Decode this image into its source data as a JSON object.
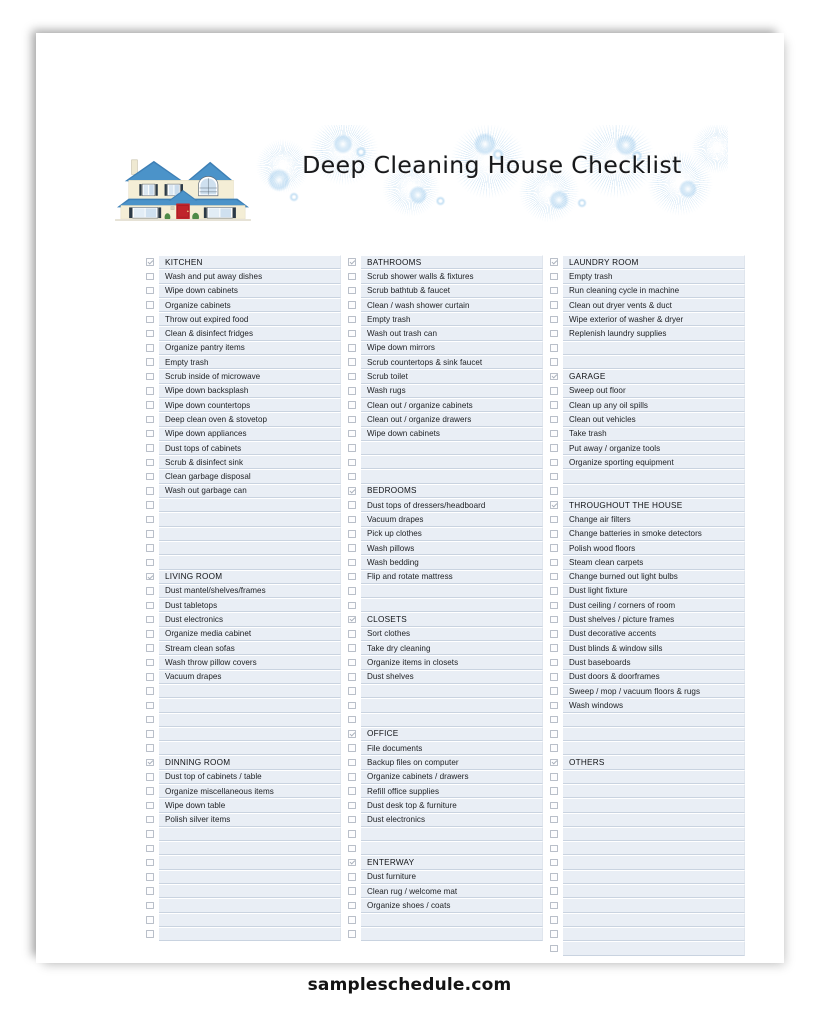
{
  "document": {
    "title": "Deep Cleaning House Checklist",
    "watermark": "sampleschedule.com",
    "logo_icon": "house-illustration-icon"
  },
  "colors": {
    "row_fill": "#e9eef5",
    "row_rule": "#c9d3e0",
    "checkbox_border": "#b9bfc9",
    "text": "#1d1f22",
    "burst_blue": "#78b4e1"
  },
  "columns": [
    {
      "name": "column-1",
      "rows": [
        {
          "type": "section",
          "checked": true,
          "label": "KITCHEN"
        },
        {
          "type": "item",
          "checked": false,
          "label": "Wash and put away dishes"
        },
        {
          "type": "item",
          "checked": false,
          "label": "Wipe down cabinets"
        },
        {
          "type": "item",
          "checked": false,
          "label": "Organize cabinets"
        },
        {
          "type": "item",
          "checked": false,
          "label": "Throw out expired food"
        },
        {
          "type": "item",
          "checked": false,
          "label": "Clean & disinfect fridges"
        },
        {
          "type": "item",
          "checked": false,
          "label": "Organize pantry items"
        },
        {
          "type": "item",
          "checked": false,
          "label": "Empty trash"
        },
        {
          "type": "item",
          "checked": false,
          "label": "Scrub inside of microwave"
        },
        {
          "type": "item",
          "checked": false,
          "label": "Wipe down backsplash"
        },
        {
          "type": "item",
          "checked": false,
          "label": "Wipe down countertops"
        },
        {
          "type": "item",
          "checked": false,
          "label": "Deep clean oven & stovetop"
        },
        {
          "type": "item",
          "checked": false,
          "label": "Wipe down appliances"
        },
        {
          "type": "item",
          "checked": false,
          "label": "Dust tops of cabinets"
        },
        {
          "type": "item",
          "checked": false,
          "label": "Scrub & disinfect sink"
        },
        {
          "type": "item",
          "checked": false,
          "label": "Clean garbage disposal"
        },
        {
          "type": "item",
          "checked": false,
          "label": "Wash out garbage can"
        },
        {
          "type": "spacer",
          "checked": false,
          "label": ""
        },
        {
          "type": "spacer",
          "checked": false,
          "label": ""
        },
        {
          "type": "spacer",
          "checked": false,
          "label": ""
        },
        {
          "type": "spacer",
          "checked": false,
          "label": ""
        },
        {
          "type": "spacer",
          "checked": false,
          "label": ""
        },
        {
          "type": "section",
          "checked": true,
          "label": "LIVING ROOM"
        },
        {
          "type": "item",
          "checked": false,
          "label": "Dust mantel/shelves/frames"
        },
        {
          "type": "item",
          "checked": false,
          "label": "Dust tabletops"
        },
        {
          "type": "item",
          "checked": false,
          "label": "Dust electronics"
        },
        {
          "type": "item",
          "checked": false,
          "label": "Organize media cabinet"
        },
        {
          "type": "item",
          "checked": false,
          "label": "Stream clean sofas"
        },
        {
          "type": "item",
          "checked": false,
          "label": "Wash throw pillow covers"
        },
        {
          "type": "item",
          "checked": false,
          "label": "Vacuum drapes"
        },
        {
          "type": "spacer",
          "checked": false,
          "label": ""
        },
        {
          "type": "spacer",
          "checked": false,
          "label": ""
        },
        {
          "type": "spacer",
          "checked": false,
          "label": ""
        },
        {
          "type": "spacer",
          "checked": false,
          "label": ""
        },
        {
          "type": "spacer",
          "checked": false,
          "label": ""
        },
        {
          "type": "section",
          "checked": true,
          "label": "DINNING ROOM"
        },
        {
          "type": "item",
          "checked": false,
          "label": "Dust top of cabinets / table"
        },
        {
          "type": "item",
          "checked": false,
          "label": "Organize miscellaneous items"
        },
        {
          "type": "item",
          "checked": false,
          "label": "Wipe down table"
        },
        {
          "type": "item",
          "checked": false,
          "label": "Polish silver items"
        },
        {
          "type": "spacer",
          "checked": false,
          "label": ""
        },
        {
          "type": "spacer",
          "checked": false,
          "label": ""
        },
        {
          "type": "spacer",
          "checked": false,
          "label": ""
        },
        {
          "type": "spacer",
          "checked": false,
          "label": ""
        },
        {
          "type": "spacer",
          "checked": false,
          "label": ""
        },
        {
          "type": "spacer",
          "checked": false,
          "label": ""
        },
        {
          "type": "spacer",
          "checked": false,
          "label": ""
        },
        {
          "type": "spacer",
          "checked": false,
          "label": ""
        }
      ]
    },
    {
      "name": "column-2",
      "rows": [
        {
          "type": "section",
          "checked": true,
          "label": "BATHROOMS"
        },
        {
          "type": "item",
          "checked": false,
          "label": "Scrub shower walls & fixtures"
        },
        {
          "type": "item",
          "checked": false,
          "label": "Scrub bathtub & faucet"
        },
        {
          "type": "item",
          "checked": false,
          "label": "Clean / wash shower curtain"
        },
        {
          "type": "item",
          "checked": false,
          "label": "Empty trash"
        },
        {
          "type": "item",
          "checked": false,
          "label": "Wash out trash can"
        },
        {
          "type": "item",
          "checked": false,
          "label": "Wipe down mirrors"
        },
        {
          "type": "item",
          "checked": false,
          "label": "Scrub countertops & sink faucet"
        },
        {
          "type": "item",
          "checked": false,
          "label": "Scrub toilet"
        },
        {
          "type": "item",
          "checked": false,
          "label": "Wash rugs"
        },
        {
          "type": "item",
          "checked": false,
          "label": "Clean out / organize cabinets"
        },
        {
          "type": "item",
          "checked": false,
          "label": "Clean out / organize drawers"
        },
        {
          "type": "item",
          "checked": false,
          "label": "Wipe down cabinets"
        },
        {
          "type": "spacer",
          "checked": false,
          "label": ""
        },
        {
          "type": "spacer",
          "checked": false,
          "label": ""
        },
        {
          "type": "spacer",
          "checked": false,
          "label": ""
        },
        {
          "type": "section",
          "checked": true,
          "label": "BEDROOMS"
        },
        {
          "type": "item",
          "checked": false,
          "label": "Dust tops of dressers/headboard"
        },
        {
          "type": "item",
          "checked": false,
          "label": "Vacuum drapes"
        },
        {
          "type": "item",
          "checked": false,
          "label": "Pick up clothes"
        },
        {
          "type": "item",
          "checked": false,
          "label": "Wash pillows"
        },
        {
          "type": "item",
          "checked": false,
          "label": "Wash bedding"
        },
        {
          "type": "item",
          "checked": false,
          "label": "Flip and rotate mattress"
        },
        {
          "type": "spacer",
          "checked": false,
          "label": ""
        },
        {
          "type": "spacer",
          "checked": false,
          "label": ""
        },
        {
          "type": "section",
          "checked": true,
          "label": "CLOSETS"
        },
        {
          "type": "item",
          "checked": false,
          "label": "Sort clothes"
        },
        {
          "type": "item",
          "checked": false,
          "label": "Take dry cleaning"
        },
        {
          "type": "item",
          "checked": false,
          "label": "Organize items in closets"
        },
        {
          "type": "item",
          "checked": false,
          "label": "Dust shelves"
        },
        {
          "type": "spacer",
          "checked": false,
          "label": ""
        },
        {
          "type": "spacer",
          "checked": false,
          "label": ""
        },
        {
          "type": "spacer",
          "checked": false,
          "label": ""
        },
        {
          "type": "section",
          "checked": true,
          "label": "OFFICE"
        },
        {
          "type": "item",
          "checked": false,
          "label": "File documents"
        },
        {
          "type": "item",
          "checked": false,
          "label": "Backup files on computer"
        },
        {
          "type": "item",
          "checked": false,
          "label": "Organize cabinets / drawers"
        },
        {
          "type": "item",
          "checked": false,
          "label": "Refill office supplies"
        },
        {
          "type": "item",
          "checked": false,
          "label": "Dust desk top & furniture"
        },
        {
          "type": "item",
          "checked": false,
          "label": "Dust electronics"
        },
        {
          "type": "spacer",
          "checked": false,
          "label": ""
        },
        {
          "type": "spacer",
          "checked": false,
          "label": ""
        },
        {
          "type": "section",
          "checked": true,
          "label": "ENTERWAY"
        },
        {
          "type": "item",
          "checked": false,
          "label": "Dust furniture"
        },
        {
          "type": "item",
          "checked": false,
          "label": "Clean rug / welcome mat"
        },
        {
          "type": "item",
          "checked": false,
          "label": "Organize shoes / coats"
        },
        {
          "type": "spacer",
          "checked": false,
          "label": ""
        },
        {
          "type": "spacer",
          "checked": false,
          "label": ""
        }
      ]
    },
    {
      "name": "column-3",
      "rows": [
        {
          "type": "section",
          "checked": true,
          "label": "LAUNDRY ROOM"
        },
        {
          "type": "item",
          "checked": false,
          "label": "Empty trash"
        },
        {
          "type": "item",
          "checked": false,
          "label": "Run cleaning cycle in machine"
        },
        {
          "type": "item",
          "checked": false,
          "label": "Clean out dryer vents & duct"
        },
        {
          "type": "item",
          "checked": false,
          "label": "Wipe exterior of washer & dryer"
        },
        {
          "type": "item",
          "checked": false,
          "label": "Replenish laundry supplies"
        },
        {
          "type": "spacer",
          "checked": false,
          "label": ""
        },
        {
          "type": "spacer",
          "checked": false,
          "label": ""
        },
        {
          "type": "section",
          "checked": true,
          "label": "GARAGE"
        },
        {
          "type": "item",
          "checked": false,
          "label": "Sweep out floor"
        },
        {
          "type": "item",
          "checked": false,
          "label": "Clean up any oil spills"
        },
        {
          "type": "item",
          "checked": false,
          "label": "Clean out vehicles"
        },
        {
          "type": "item",
          "checked": false,
          "label": "Take trash"
        },
        {
          "type": "item",
          "checked": false,
          "label": "Put away / organize tools"
        },
        {
          "type": "item",
          "checked": false,
          "label": "Organize sporting equipment"
        },
        {
          "type": "spacer",
          "checked": false,
          "label": ""
        },
        {
          "type": "spacer",
          "checked": false,
          "label": ""
        },
        {
          "type": "section",
          "checked": true,
          "label": "THROUGHOUT THE HOUSE"
        },
        {
          "type": "item",
          "checked": false,
          "label": "Change air filters"
        },
        {
          "type": "item",
          "checked": false,
          "label": "Change batteries in smoke detectors"
        },
        {
          "type": "item",
          "checked": false,
          "label": "Polish wood floors"
        },
        {
          "type": "item",
          "checked": false,
          "label": "Steam clean carpets"
        },
        {
          "type": "item",
          "checked": false,
          "label": "Change burned out light bulbs"
        },
        {
          "type": "item",
          "checked": false,
          "label": "Dust light fixture"
        },
        {
          "type": "item",
          "checked": false,
          "label": "Dust ceiling / corners of room"
        },
        {
          "type": "item",
          "checked": false,
          "label": "Dust shelves / picture frames"
        },
        {
          "type": "item",
          "checked": false,
          "label": "Dust decorative accents"
        },
        {
          "type": "item",
          "checked": false,
          "label": "Dust blinds & window sills"
        },
        {
          "type": "item",
          "checked": false,
          "label": "Dust baseboards"
        },
        {
          "type": "item",
          "checked": false,
          "label": "Dust doors & doorframes"
        },
        {
          "type": "item",
          "checked": false,
          "label": "Sweep / mop / vacuum floors & rugs"
        },
        {
          "type": "item",
          "checked": false,
          "label": "Wash windows"
        },
        {
          "type": "spacer",
          "checked": false,
          "label": ""
        },
        {
          "type": "spacer",
          "checked": false,
          "label": ""
        },
        {
          "type": "spacer",
          "checked": false,
          "label": ""
        },
        {
          "type": "section",
          "checked": true,
          "label": "OTHERS"
        },
        {
          "type": "spacer",
          "checked": false,
          "label": ""
        },
        {
          "type": "spacer",
          "checked": false,
          "label": ""
        },
        {
          "type": "spacer",
          "checked": false,
          "label": ""
        },
        {
          "type": "spacer",
          "checked": false,
          "label": ""
        },
        {
          "type": "spacer",
          "checked": false,
          "label": ""
        },
        {
          "type": "spacer",
          "checked": false,
          "label": ""
        },
        {
          "type": "spacer",
          "checked": false,
          "label": ""
        },
        {
          "type": "spacer",
          "checked": false,
          "label": ""
        },
        {
          "type": "spacer",
          "checked": false,
          "label": ""
        },
        {
          "type": "spacer",
          "checked": false,
          "label": ""
        },
        {
          "type": "spacer",
          "checked": false,
          "label": ""
        },
        {
          "type": "spacer",
          "checked": false,
          "label": ""
        },
        {
          "type": "spacer",
          "checked": false,
          "label": ""
        }
      ]
    }
  ]
}
